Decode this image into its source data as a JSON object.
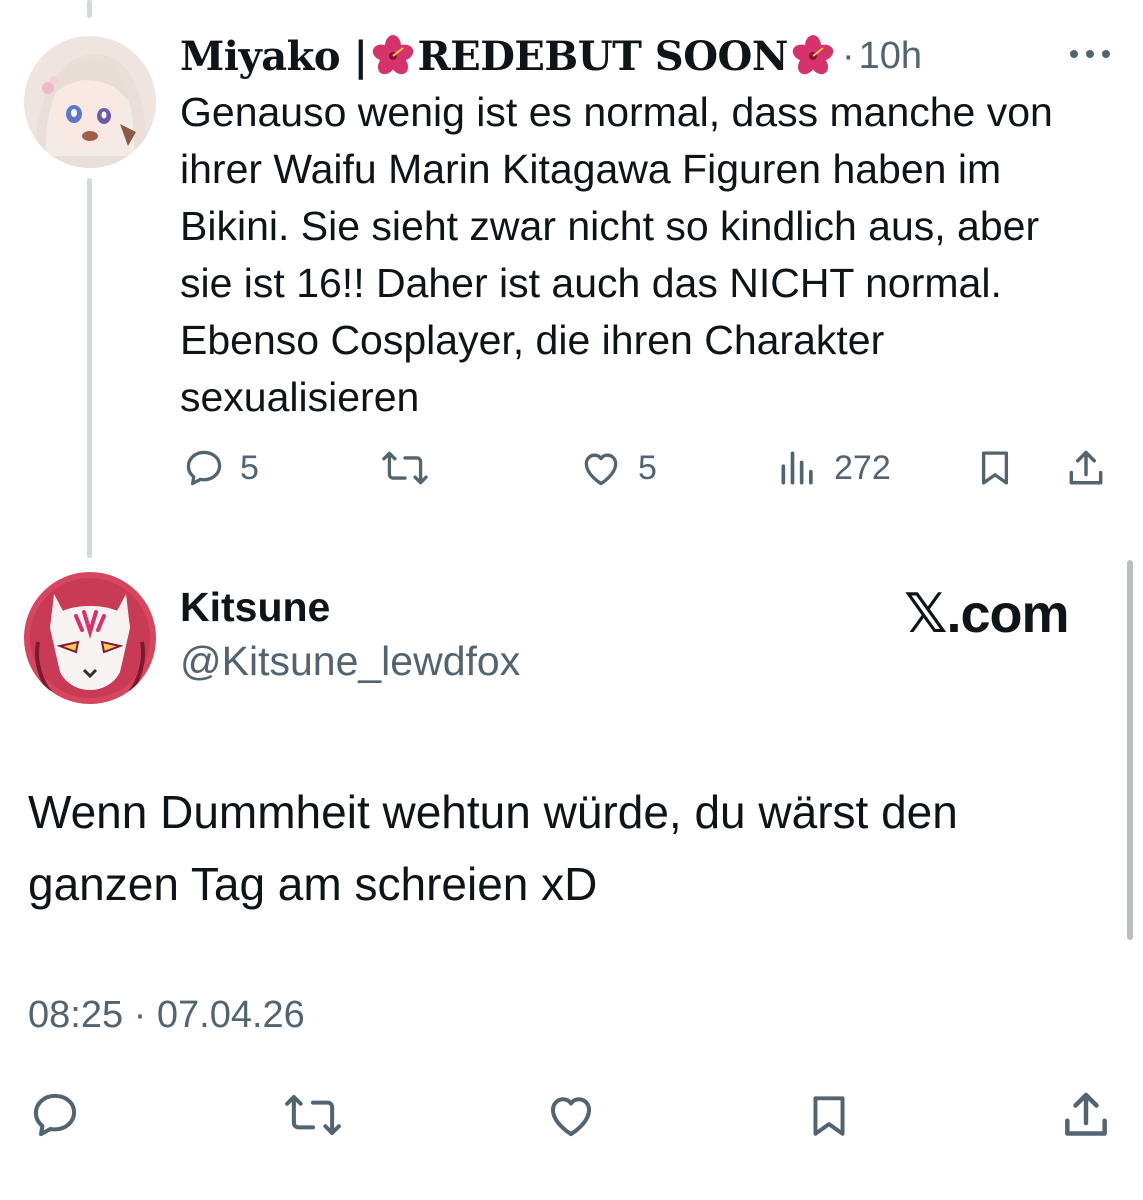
{
  "reply": {
    "author_name": "Miyako | ",
    "author_suffix": "REDEBUT SOON",
    "separator": "·",
    "time": "10h",
    "text": "Genauso wenig ist es normal, dass manche von ihrer Waifu Marin Kitagawa Figuren haben im Bikini. Sie sieht zwar nicht so kindlich aus, aber sie ist 16!! Daher ist auch das NICHT normal. Ebenso Cosplayer, die ihren Charakter sexualisieren",
    "actions": {
      "replies": "5",
      "retweets": "",
      "likes": "5",
      "views": "272"
    }
  },
  "post": {
    "author_name": "Kitsune",
    "author_handle": "@Kitsune_lewdfox",
    "watermark": "𝕏.com",
    "text": "Wenn Dummheit wehtun würde, du wärst den ganzen Tag am schreien xD",
    "timestamp": "08:25 · 07.04.26"
  },
  "colors": {
    "text": "#0f1419",
    "muted": "#536471",
    "thread_line": "#cfd9de",
    "flower": "#d6336c"
  },
  "icons": [
    "more-icon",
    "reply-icon",
    "retweet-icon",
    "like-icon",
    "views-icon",
    "bookmark-icon",
    "share-icon",
    "hibiscus-flower-icon"
  ]
}
